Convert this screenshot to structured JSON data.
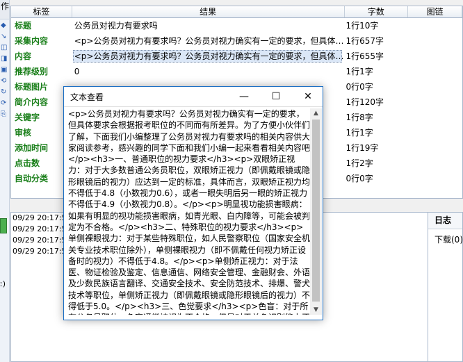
{
  "left_strip": {
    "top_label": "作",
    "bottom_label": "ː)"
  },
  "table": {
    "headers": [
      "标签",
      "结果",
      "字数",
      "图链"
    ],
    "rows": [
      {
        "label": "标题",
        "result": "公务员对视力有要求吗",
        "count": "1行10字"
      },
      {
        "label": "采集内容",
        "result": "<p>公务员对视力有要求吗？公务员对视力确实有一定的要求，但具体…",
        "count": "1行657字"
      },
      {
        "label": "内容",
        "result": "<p>公务员对视力有要求吗？公务员对视力确实有一定的要求，但具体…",
        "count": "1行655字"
      },
      {
        "label": "推荐级别",
        "result": "0",
        "count": "1行1字"
      },
      {
        "label": "标题图片",
        "result": "",
        "count": "0行0字"
      },
      {
        "label": "简介内容",
        "result": "",
        "count": "1行120字"
      },
      {
        "label": "关键字",
        "result": "",
        "count": "1行8字"
      },
      {
        "label": "审核",
        "result": "",
        "count": "1行1字"
      },
      {
        "label": "添加时间",
        "result": "",
        "count": "1行19字"
      },
      {
        "label": "点击数",
        "result": "",
        "count": "1行2字"
      },
      {
        "label": "自动分类",
        "result": "",
        "count": "0行0字"
      }
    ]
  },
  "log": {
    "lines": [
      "09/29 20:17:5",
      "09/29 20:17:5",
      "09/29 20:17:5",
      "09/29 20:17:5"
    ]
  },
  "side": {
    "tab": "日志",
    "text": "下载(0)"
  },
  "dialog": {
    "title": "文本查看",
    "min_glyph": "—",
    "max_glyph": "☐",
    "close_glyph": "✕",
    "content": "<p>公务员对视力有要求吗？公务员对视力确实有一定的要求，但具体要求会根据报考职位的不同而有所差异。为了方便小伙伴们了解，下面我们小编整理了公务员对视力有要求吗的相关内容供大家阅读参考，感兴趣的同学下面和我们小编一起来看看相关内容吧</p><h3>一、普通职位的视力要求</h3><p>双眼矫正视力：对于大多数普通公务员职位，双眼矫正视力（即佩戴眼镜或隐形眼镜后的视力）应达到一定的标准，具体而言，双眼矫正视力均不得低于4.8（小数视力0.6），或者一眼失明后另一眼的矫正视力不得低于4.9（小数视力0.8）。</p><p>明显视功能损害眼病：如果有明显的视功能损害眼病，如青光眼、白内障等，可能会被判定为不合格。</p><h3>二、特殊职位的视力要求</h3><p>单侧裸眼视力：对于某些特殊职位，如人民警察职位（国家安全机关专业技术职位除外），单侧裸眼视力（即不佩戴任何视力矫正设备时的视力）不得低于4.8。</p><p>单侧矫正视力：对于法医、物证检验及鉴定、信息通信、网络安全管理、金融财会、外语及少数民族语言翻译、交通安全技术、安全防范技术、排爆、警犬技术等职位，单侧矫正视力（即佩戴眼镜或隐形眼镜后的视力）不得低于5.0。</p><h3>三、色觉要求</h3><p>色盲：对于所有公务员职位，色盲通常被视为不合格，但是对于单色识别能力正常"
  },
  "colors": {
    "label_green": "#1a7f1a",
    "accent_blue": "#1c6fc4"
  }
}
